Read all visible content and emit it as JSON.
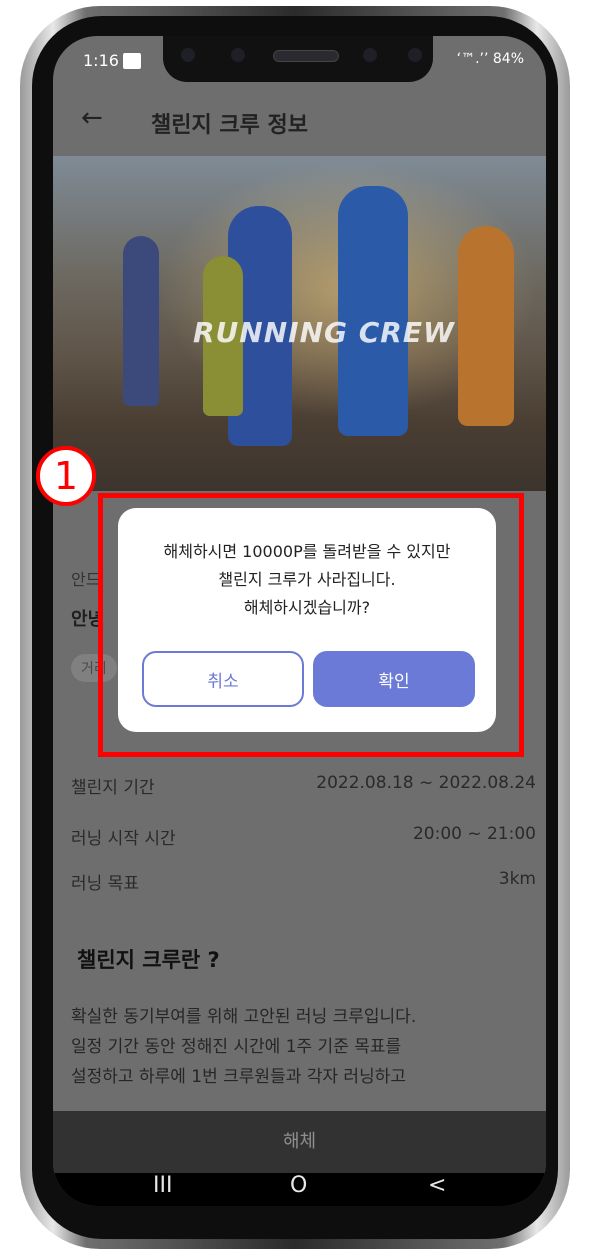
{
  "status": {
    "time": "1:16",
    "right": "‘™.’’ 84%"
  },
  "appbar": {
    "back": "←",
    "title": "챌린지 크루 정보"
  },
  "hero": {
    "text": "RUNNING CREW"
  },
  "content": {
    "small_label": "안드",
    "bold_label": "안녕",
    "chip": "거리",
    "rows": [
      {
        "label": "챌린지 기간",
        "value": "2022.08.18 ~ 2022.08.24"
      },
      {
        "label": "러닝 시작 시간",
        "value": "20:00 ~ 21:00"
      },
      {
        "label": "러닝 목표",
        "value": "3km"
      }
    ],
    "section_title": "챌린지 크루란 ?",
    "desc": [
      "확실한 동기부여를 위해 고안된 러닝 크루입니다.",
      "일정 기간 동안 정해진 시간에 1주 기준 목표를",
      "설정하고 하루에 1번 크루원들과 각자 러닝하고"
    ]
  },
  "bottom_action": "해체",
  "dialog": {
    "lines": [
      "해체하시면 10000P를 돌려받을 수 있지만",
      "챌린지 크루가 사라집니다.",
      "해체하시겠습니까?"
    ],
    "cancel": "취소",
    "confirm": "확인"
  },
  "nav": {
    "recent": "III",
    "home": "O",
    "back": "<"
  },
  "annotation": {
    "number": "1"
  },
  "colors": {
    "accent": "#6b7ad6",
    "annotation": "#ff0000"
  }
}
